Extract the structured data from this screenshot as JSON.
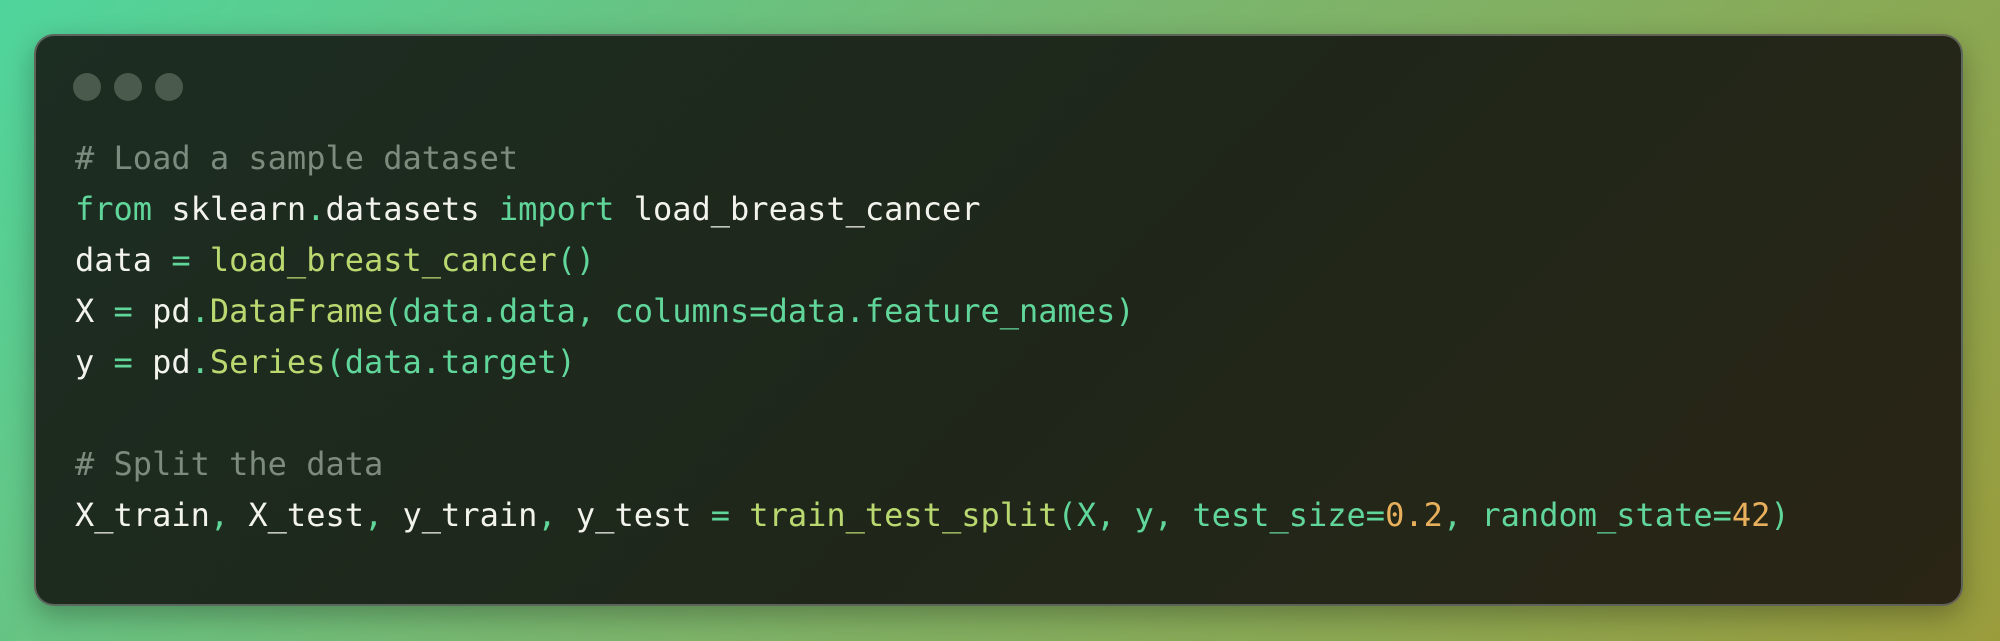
{
  "colors": {
    "background_start": "#4fd59c",
    "background_end": "#9a9c3c",
    "window_background": "#1c2d22",
    "comment": "#7c8b7e",
    "keyword": "#61d69b",
    "function": "#bad870",
    "number": "#e8b05c",
    "text": "#f3f3ee"
  },
  "window_controls": [
    "close-dot",
    "minimize-dot",
    "zoom-dot"
  ],
  "code": {
    "l1": {
      "comment": "# Load a sample dataset"
    },
    "l2": {
      "kw_from": "from",
      "module_a": "sklearn",
      "dot": ".",
      "module_b": "datasets",
      "kw_import": "import",
      "name": "load_breast_cancer"
    },
    "l3": {
      "var": "data",
      "eq": "=",
      "fn": "load_breast_cancer",
      "parens": "()"
    },
    "l4": {
      "var": "X",
      "eq": "=",
      "obj": "pd",
      "dot": ".",
      "fn": "DataFrame",
      "args": "(data.data, columns=data.feature_names)"
    },
    "l5": {
      "var": "y",
      "eq": "=",
      "obj": "pd",
      "dot": ".",
      "fn": "Series",
      "args": "(data.target)"
    },
    "l7": {
      "comment": "# Split the data"
    },
    "l8": {
      "v1": "X_train",
      "c1": ",",
      "v2": "X_test",
      "c2": ",",
      "v3": "y_train",
      "c3": ",",
      "v4": "y_test",
      "eq": "=",
      "fn": "train_test_split",
      "args_a": "(X, y, test_size=",
      "n1": "0.2",
      "args_b": ", random_state=",
      "n2": "42",
      "close": ")"
    }
  }
}
